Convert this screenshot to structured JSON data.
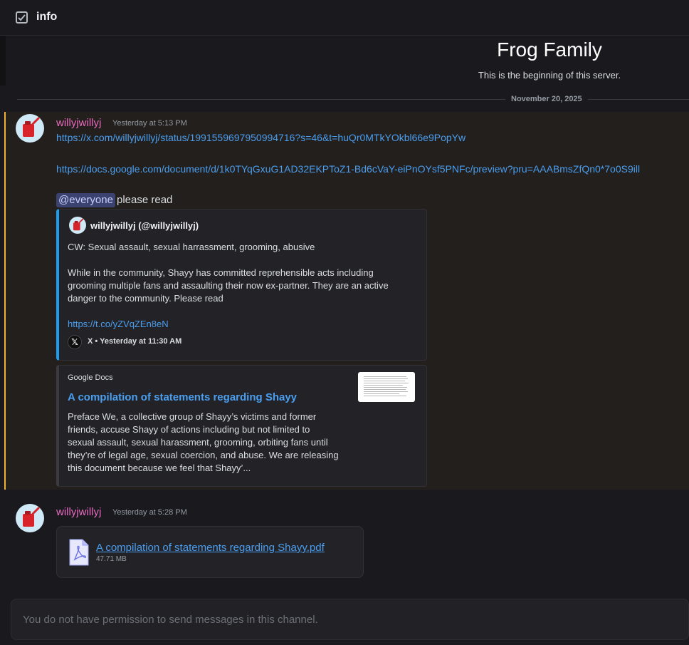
{
  "header": {
    "channel_icon": "checkbox-icon",
    "channel_name": "info"
  },
  "intro": {
    "server_name": "Frog Family",
    "subtitle": "This is the beginning of this server."
  },
  "date_divider": "November 20, 2025",
  "messages": [
    {
      "author": "willyjwillyj",
      "timestamp": "Yesterday at 5:13 PM",
      "links": [
        "https://x.com/willyjwillyj/status/1991559697950994716?s=46&t=huQr0MTkYOkbl66e9PopYw",
        "https://docs.google.com/document/d/1k0TYqGxuG1AD32EKPToZ1-Bd6cVaY-eiPnOYsf5PNFc/preview?pru=AAABmsZfQn0*7o0S9ill"
      ],
      "mention": "@everyone",
      "text": "please read",
      "embed_x": {
        "author": "willyjwillyj (@willyjwillyj)",
        "line1": "CW: Sexual assault, sexual harrassment, grooming, abusive",
        "para": [
          "While in the community, Shayy has committed reprehensible acts including",
          "grooming multiple fans and assaulting their now ex-partner. They are an active",
          "danger to the community. Please read"
        ],
        "link": "https://t.co/yZVqZEn8eN",
        "footer": "X • Yesterday at 11:30 AM"
      },
      "embed_docs": {
        "provider": "Google Docs",
        "title": "A compilation of statements regarding Shayy",
        "description": [
          "Preface We, a collective group of Shayy’s victims and former",
          "friends, accuse Shayy of actions including but not limited to",
          "sexual assault, sexual harassment, grooming, orbiting fans until",
          "they’re of legal age, sexual coercion, and abuse. We are releasing",
          "this document because we feel that Shayy’..."
        ]
      }
    },
    {
      "author": "willyjwillyj",
      "timestamp": "Yesterday at 5:28 PM",
      "attachment": {
        "name": "A compilation of statements regarding Shayy.pdf",
        "size": "47.71 MB",
        "icon": "pdf-file-icon"
      }
    }
  ],
  "composer": {
    "placeholder": "You do not have permission to send messages in this channel."
  },
  "colors": {
    "link": "#4a9ef0",
    "username": "#e76bbf",
    "mention_bar": "#f0b232",
    "x_embed_bar": "#1d9bf0"
  }
}
